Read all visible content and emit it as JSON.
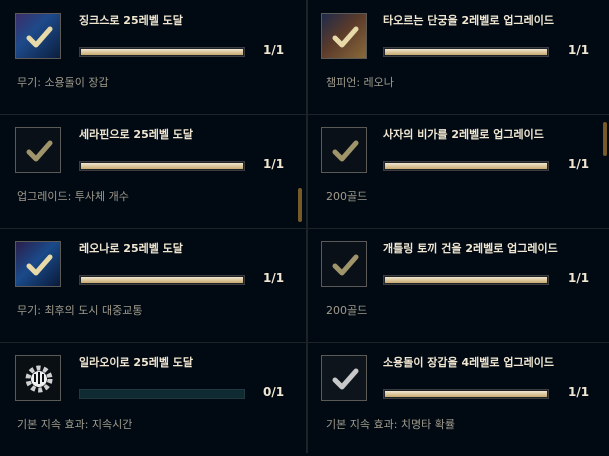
{
  "left_column": [
    {
      "title": "징크스로 25레벨 도달",
      "progress": "1/1",
      "reward": "무기: 소용돌이 장갑",
      "fill": 1
    },
    {
      "title": "세라핀으로 25레벨 도달",
      "progress": "1/1",
      "reward": "업그레이드: 투사체 개수",
      "fill": 1
    },
    {
      "title": "레오나로 25레벨 도달",
      "progress": "1/1",
      "reward": "무기: 최후의 도시 대중교통",
      "fill": 1
    },
    {
      "title": "일라오이로 25레벨 도달",
      "progress": "0/1",
      "reward": "기본 지속 효과: 지속시간",
      "fill": 0
    }
  ],
  "right_column": [
    {
      "title": "타오르는 단궁을 2레벨로 업그레이드",
      "progress": "1/1",
      "reward": "챔피언: 레오나",
      "fill": 1
    },
    {
      "title": "사자의 비가를 2레벨로 업그레이드",
      "progress": "1/1",
      "reward": "200골드",
      "fill": 1
    },
    {
      "title": "개틀링 토끼 건을 2레벨로 업그레이드",
      "progress": "1/1",
      "reward": "200골드",
      "fill": 1
    },
    {
      "title": "소용돌이 장갑을 4레벨로 업그레이드",
      "progress": "1/1",
      "reward": "기본 지속 효과: 치명타 확률",
      "fill": 1
    }
  ],
  "colors": {
    "gold": "#c8aa6e",
    "text": "#f0e6d2",
    "muted": "#a09b8c",
    "bg": "#010a13"
  }
}
